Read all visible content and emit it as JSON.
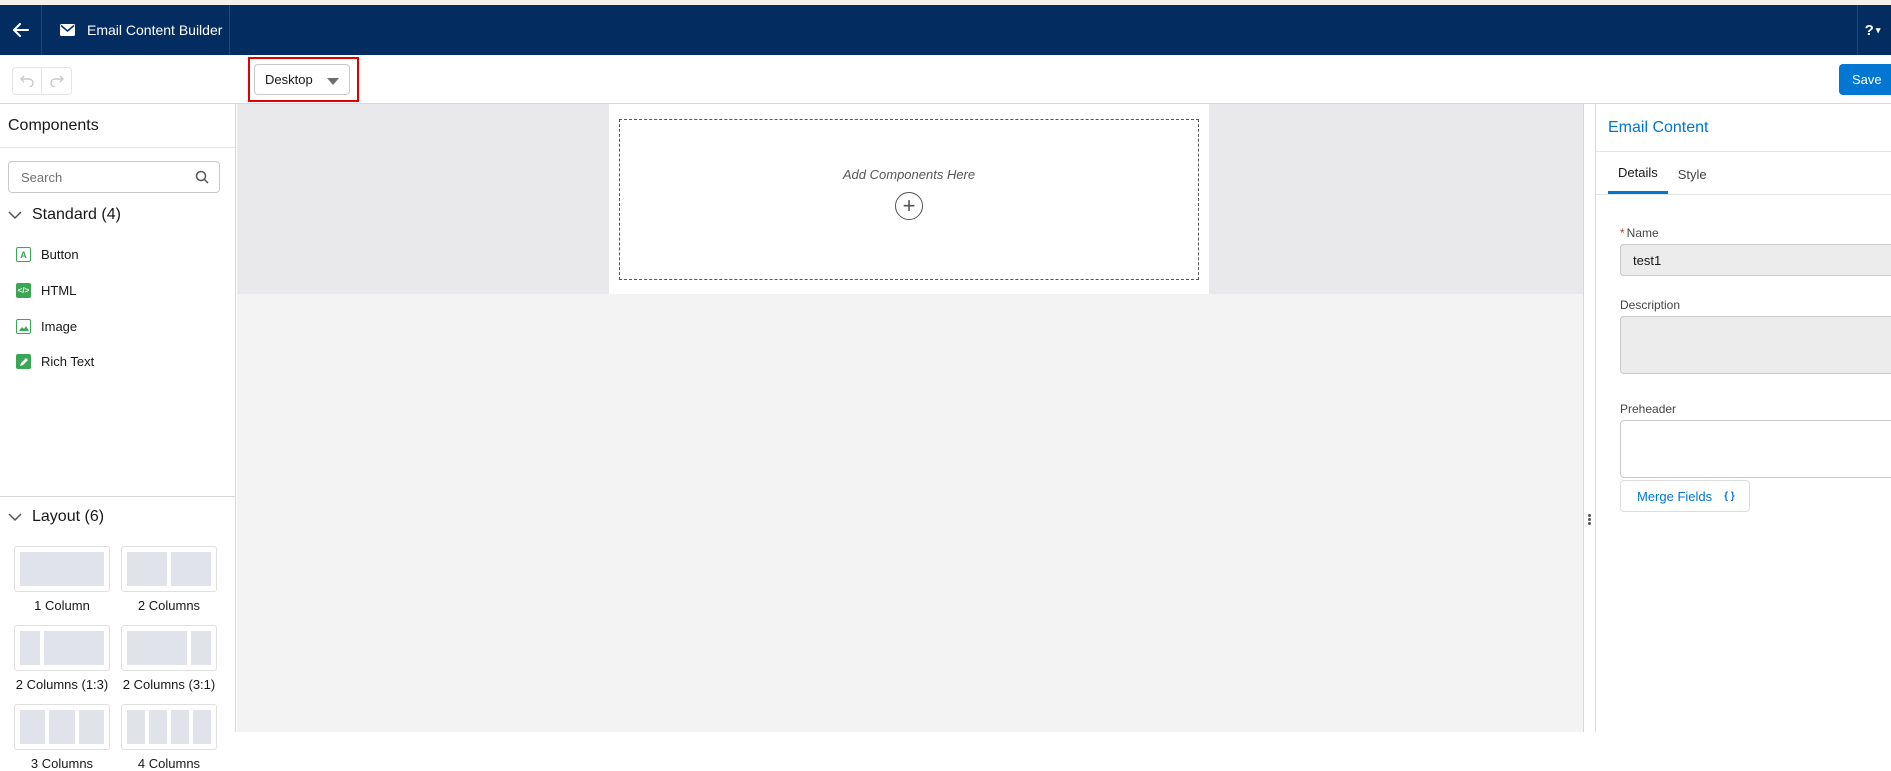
{
  "header": {
    "title": "Email Content Builder",
    "help": "?"
  },
  "toolbar": {
    "device_selected": "Desktop",
    "save_label": "Save"
  },
  "components_panel": {
    "title": "Components",
    "search_placeholder": "Search",
    "standard_heading": "Standard (4)",
    "standard_items": [
      {
        "label": "Button",
        "icon": "button-icon",
        "color": "#3ba755"
      },
      {
        "label": "HTML",
        "icon": "html-code-icon",
        "color": "#3ba755"
      },
      {
        "label": "Image",
        "icon": "image-icon",
        "color": "#3ba755"
      },
      {
        "label": "Rich Text",
        "icon": "rich-text-pencil-icon",
        "color": "#3ba755"
      }
    ],
    "layout_heading": "Layout (6)",
    "layouts": [
      {
        "label": "1 Column"
      },
      {
        "label": "2 Columns"
      },
      {
        "label": "2 Columns (1:3)"
      },
      {
        "label": "2 Columns (3:1)"
      },
      {
        "label": "3 Columns"
      },
      {
        "label": "4 Columns"
      }
    ]
  },
  "canvas": {
    "drop_text": "Add Components Here",
    "add_icon": "plus-circle-icon"
  },
  "properties_panel": {
    "title": "Email Content",
    "tabs": [
      {
        "label": "Details",
        "active": true
      },
      {
        "label": "Style",
        "active": false
      }
    ],
    "name_label": "Name",
    "name_value": "test1",
    "description_label": "Description",
    "preheader_label": "Preheader",
    "merge_fields_label": "Merge Fields",
    "merge_fields_glyph": "{ }"
  },
  "colors": {
    "header_bg": "#032d60",
    "accent": "#0176d3",
    "highlight": "#e00000",
    "component_icon": "#3ba755"
  }
}
